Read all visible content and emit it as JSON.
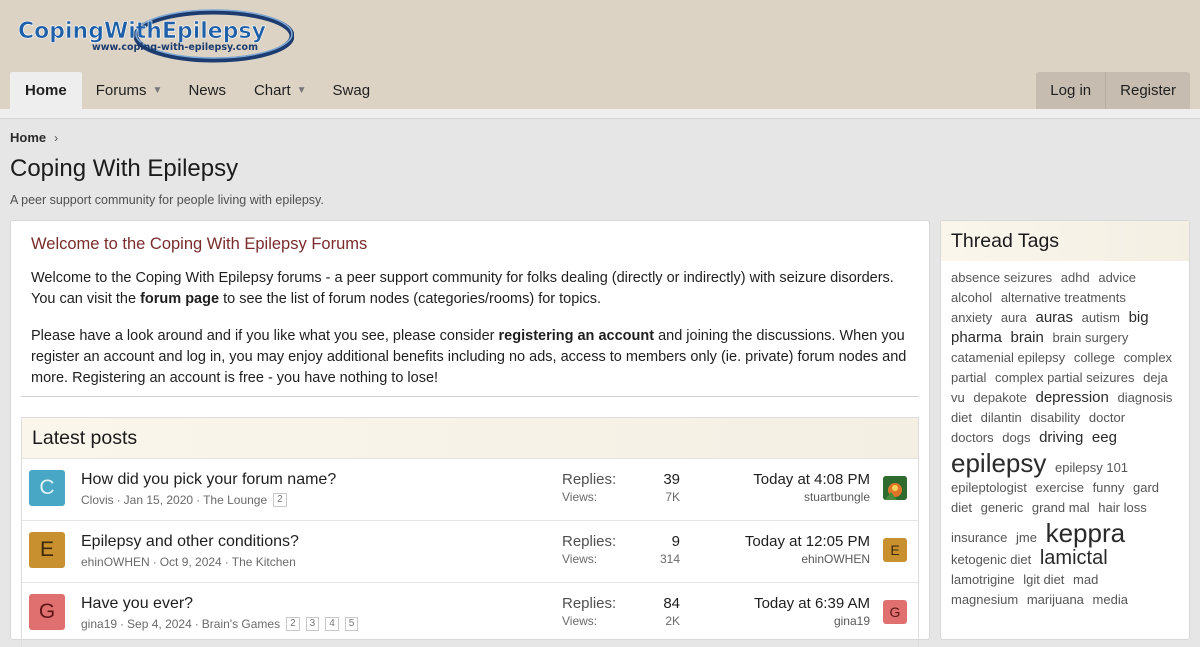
{
  "logo": {
    "name": "CopingWithEpilepsy",
    "url": "www.coping-with-epilepsy.com"
  },
  "nav": {
    "tabs": [
      {
        "label": "Home",
        "active": true,
        "caret": false
      },
      {
        "label": "Forums",
        "active": false,
        "caret": true
      },
      {
        "label": "News",
        "active": false,
        "caret": false
      },
      {
        "label": "Chart",
        "active": false,
        "caret": true
      },
      {
        "label": "Swag",
        "active": false,
        "caret": false
      }
    ],
    "login": "Log in",
    "register": "Register"
  },
  "breadcrumb": {
    "home": "Home"
  },
  "page": {
    "title": "Coping With Epilepsy",
    "description": "A peer support community for people living with epilepsy."
  },
  "welcome": {
    "title": "Welcome to the Coping With Epilepsy Forums",
    "p1_a": "Welcome to the Coping With Epilepsy forums - a peer support community for folks dealing (directly or indirectly) with seizure disorders. You can visit the ",
    "p1_link": "forum page",
    "p1_b": " to see the list of forum nodes (categories/rooms) for topics.",
    "p2_a": "Please have a look around and if you like what you see, please consider ",
    "p2_link": "registering an account",
    "p2_b": " and joining the discussions. When you register an account and log in, you may enjoy additional benefits including no ads, access to members only (ie. private) forum nodes and more. Registering an account is free - you have nothing to lose!"
  },
  "latest": {
    "title": "Latest posts",
    "replies_label": "Replies:",
    "views_label": "Views:",
    "threads": [
      {
        "avatar_letter": "C",
        "avatar_bg": "#47a7c4",
        "avatar_fg": "#e0f3f8",
        "title": "How did you pick your forum name?",
        "author": "Clovis",
        "date": "Jan 15, 2020",
        "forum": "The Lounge",
        "pages": [
          "2"
        ],
        "replies": "39",
        "views": "7K",
        "last_time": "Today at 4:08 PM",
        "last_user": "stuartbungle",
        "last_avatar": "image",
        "last_letter": "",
        "last_bg": "#3f7d3a",
        "last_fg": "#fff"
      },
      {
        "avatar_letter": "E",
        "avatar_bg": "#c8902e",
        "avatar_fg": "#3d2a0a",
        "title": "Epilepsy and other conditions?",
        "author": "ehinOWHEN",
        "date": "Oct 9, 2024",
        "forum": "The Kitchen",
        "pages": [],
        "replies": "9",
        "views": "314",
        "last_time": "Today at 12:05 PM",
        "last_user": "ehinOWHEN",
        "last_avatar": "letter",
        "last_letter": "E",
        "last_bg": "#c8902e",
        "last_fg": "#3d2a0a"
      },
      {
        "avatar_letter": "G",
        "avatar_bg": "#e07070",
        "avatar_fg": "#5e1616",
        "title": "Have you ever?",
        "author": "gina19",
        "date": "Sep 4, 2024",
        "forum": "Brain's Games",
        "pages": [
          "2",
          "3",
          "4",
          "5"
        ],
        "replies": "84",
        "views": "2K",
        "last_time": "Today at 6:39 AM",
        "last_user": "gina19",
        "last_avatar": "letter",
        "last_letter": "G",
        "last_bg": "#e07070",
        "last_fg": "#5e1616"
      }
    ]
  },
  "sidebar": {
    "title": "Thread Tags",
    "tags": [
      {
        "t": "absence seizures",
        "s": 13
      },
      {
        "t": "adhd",
        "s": 13
      },
      {
        "t": "advice",
        "s": 13
      },
      {
        "t": "alcohol",
        "s": 13
      },
      {
        "t": "alternative treatments",
        "s": 13
      },
      {
        "t": "anxiety",
        "s": 13
      },
      {
        "t": "aura",
        "s": 13
      },
      {
        "t": "auras",
        "s": 15
      },
      {
        "t": "autism",
        "s": 13
      },
      {
        "t": "big",
        "s": 15
      },
      {
        "t": "pharma",
        "s": 15
      },
      {
        "t": "brain",
        "s": 15
      },
      {
        "t": "brain surgery",
        "s": 13
      },
      {
        "t": "catamenial epilepsy",
        "s": 13
      },
      {
        "t": "college",
        "s": 13
      },
      {
        "t": "complex",
        "s": 13
      },
      {
        "t": "partial",
        "s": 13
      },
      {
        "t": "complex partial seizures",
        "s": 13
      },
      {
        "t": "deja",
        "s": 13
      },
      {
        "t": "vu",
        "s": 13
      },
      {
        "t": "depakote",
        "s": 13
      },
      {
        "t": "depression",
        "s": 15
      },
      {
        "t": "diagnosis",
        "s": 13
      },
      {
        "t": "diet",
        "s": 13
      },
      {
        "t": "dilantin",
        "s": 13
      },
      {
        "t": "disability",
        "s": 13
      },
      {
        "t": "doctor",
        "s": 13
      },
      {
        "t": "doctors",
        "s": 13
      },
      {
        "t": "dogs",
        "s": 13
      },
      {
        "t": "driving",
        "s": 15
      },
      {
        "t": "eeg",
        "s": 15
      },
      {
        "t": "epilepsy",
        "s": 26
      },
      {
        "t": "epilepsy 101",
        "s": 13
      },
      {
        "t": "epileptologist",
        "s": 13
      },
      {
        "t": "exercise",
        "s": 13
      },
      {
        "t": "funny",
        "s": 13
      },
      {
        "t": "gard",
        "s": 13
      },
      {
        "t": "diet",
        "s": 13
      },
      {
        "t": "generic",
        "s": 13
      },
      {
        "t": "grand mal",
        "s": 13
      },
      {
        "t": "hair loss",
        "s": 13
      },
      {
        "t": "insurance",
        "s": 13
      },
      {
        "t": "jme",
        "s": 13
      },
      {
        "t": "keppra",
        "s": 26
      },
      {
        "t": "ketogenic diet",
        "s": 13
      },
      {
        "t": "lamictal",
        "s": 20
      },
      {
        "t": "lamotrigine",
        "s": 13
      },
      {
        "t": "lgit diet",
        "s": 13
      },
      {
        "t": "mad",
        "s": 13
      },
      {
        "t": "magnesium",
        "s": 13
      },
      {
        "t": "marijuana",
        "s": 13
      },
      {
        "t": "media",
        "s": 13
      }
    ]
  },
  "colors": {
    "header_bg": "#dcd3c5",
    "accent_title": "#7a2b2b",
    "logo_blue": "#1f5fa8"
  }
}
